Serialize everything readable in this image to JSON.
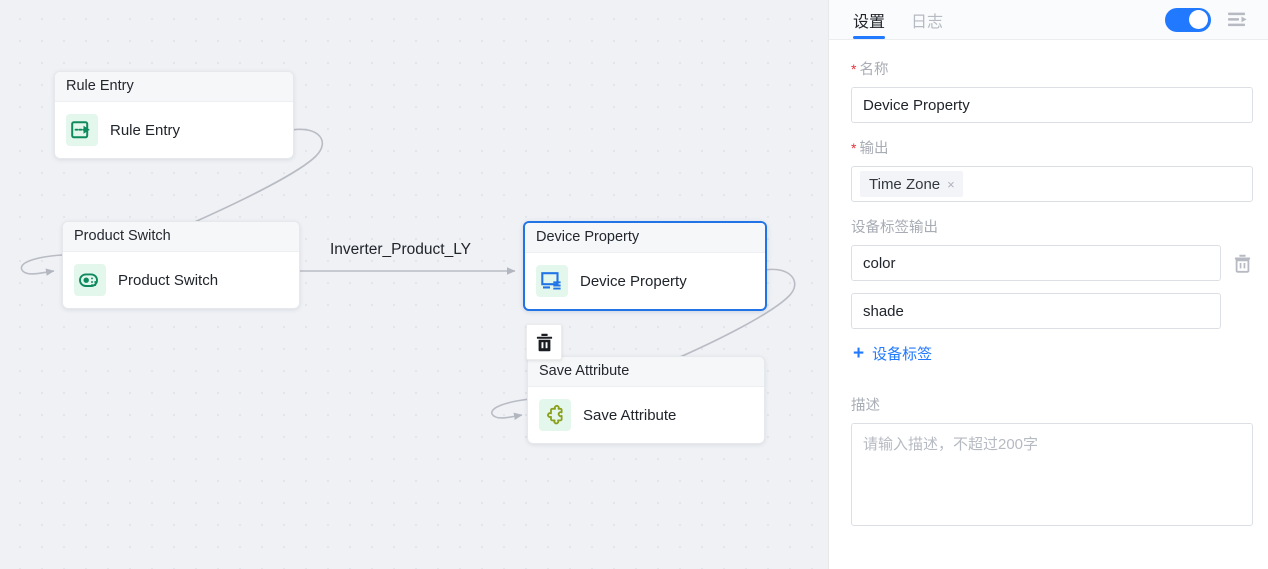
{
  "canvas": {
    "nodes": [
      {
        "id": "rule-entry",
        "title": "Rule Entry",
        "label": "Rule Entry",
        "icon": "rule-entry-icon",
        "selected": false
      },
      {
        "id": "product-switch",
        "title": "Product Switch",
        "label": "Product Switch",
        "icon": "product-switch-icon",
        "selected": false
      },
      {
        "id": "device-property",
        "title": "Device Property",
        "label": "Device Property",
        "icon": "device-property-icon",
        "selected": true
      },
      {
        "id": "save-attribute",
        "title": "Save Attribute",
        "label": "Save Attribute",
        "icon": "save-attribute-icon",
        "selected": false
      }
    ],
    "edge_label": "Inverter_Product_LY",
    "delete_button_icon": "trash-icon",
    "colors": {
      "background": "#eff1f5",
      "dot": "#e2e5ea",
      "edge": "#b9bcc4",
      "selected_border": "#2274e6",
      "icon_green": "#0f8a5f",
      "icon_blue": "#2274e6",
      "icon_olive": "#8aa01a",
      "icon_bg": "#e4f7ec"
    }
  },
  "panel": {
    "tabs": [
      {
        "id": "settings",
        "label": "设置",
        "active": true
      },
      {
        "id": "logs",
        "label": "日志",
        "active": false
      }
    ],
    "toggle": {
      "name": "enable-toggle",
      "on": true,
      "color": "#2179ff"
    },
    "collapse_icon": "panel-collapse-icon",
    "form": {
      "name": {
        "label": "名称",
        "required": true,
        "value": "Device Property",
        "placeholder": ""
      },
      "output": {
        "label": "输出",
        "required": true,
        "chips": [
          {
            "label": "Time Zone",
            "close": "×"
          }
        ]
      },
      "device_tag_output": {
        "label": "设备标签输出",
        "required": false,
        "rows": [
          {
            "value": "color",
            "deletable": true,
            "delete_icon": "trash-icon"
          },
          {
            "value": "shade",
            "deletable": false,
            "delete_icon": ""
          }
        ],
        "add_label": "设备标签",
        "add_plus": "+"
      },
      "description": {
        "label": "描述",
        "required": false,
        "value": "",
        "placeholder": "请输入描述，不超过200字"
      }
    }
  }
}
